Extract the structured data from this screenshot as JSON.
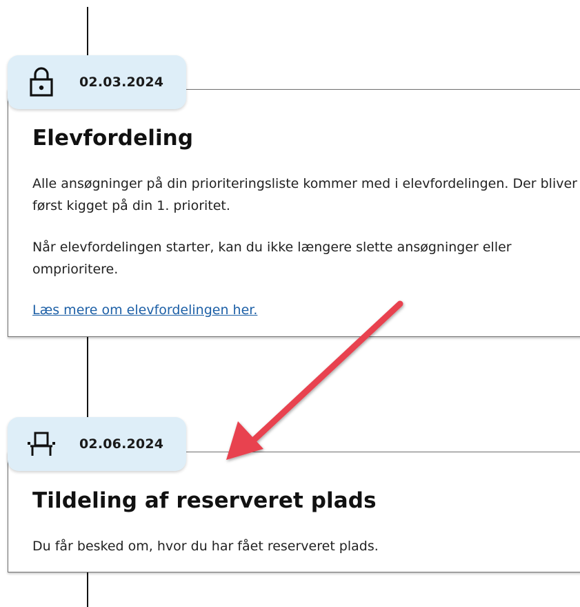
{
  "events": [
    {
      "date": "02.03.2024",
      "icon": "lock-icon",
      "title": "Elevfordeling",
      "paragraphs": [
        "Alle ansøgninger på din prioriteringsliste kommer med i elevfordelingen. Der bliver først kigget på din 1. prioritet.",
        "Når elevfordelingen starter, kan du ikke længere slette ansøgninger eller omprioritere."
      ],
      "link": "Læs mere om elevfordelingen her."
    },
    {
      "date": "02.06.2024",
      "icon": "reserved-seat-icon",
      "title": "Tildeling af reserveret plads",
      "paragraphs": [
        "Du får besked om, hvor du har fået reserveret plads."
      ]
    }
  ],
  "colors": {
    "badge_background": "#deeef8",
    "link": "#1c5fa6",
    "annotation_arrow": "#e8434f"
  }
}
